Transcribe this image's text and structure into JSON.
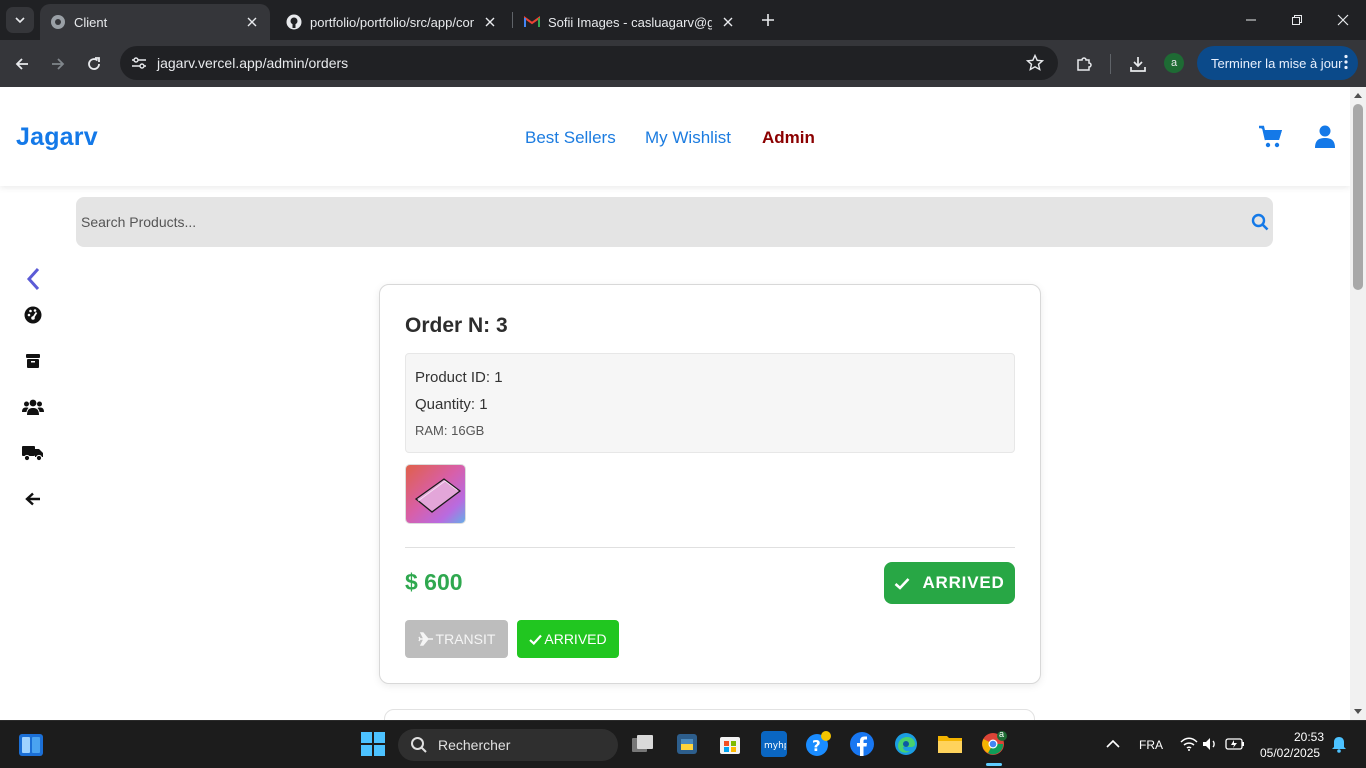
{
  "browser": {
    "tabs": [
      {
        "title": "Client",
        "icon": "globe-icon",
        "active": true
      },
      {
        "title": "portfolio/portfolio/src/app/com",
        "icon": "github-icon",
        "active": false
      },
      {
        "title": "Sofii Images - casluagarv@gma",
        "icon": "gmail-icon",
        "active": false
      }
    ],
    "url": "jagarv.vercel.app/admin/orders",
    "profile_initial": "a",
    "update_button": "Terminer la mise à jour"
  },
  "site": {
    "logo": "Jagarv",
    "nav": [
      "Best Sellers",
      "My Wishlist",
      "Admin"
    ],
    "search_placeholder": "Search Products..."
  },
  "order": {
    "title": "Order N: 3",
    "product_id": "Product ID: 1",
    "quantity": "Quantity: 1",
    "ram": "RAM: 16GB",
    "price": "$ 600",
    "status": "ARRIVED",
    "status_color": "#28a745",
    "transit_label": "TRANSIT",
    "arrived_label": "ARRIVED"
  },
  "taskbar": {
    "search_placeholder": "Rechercher",
    "language": "FRA",
    "time": "20:53",
    "date": "05/02/2025",
    "notification_badge": "a"
  },
  "colors": {
    "brand_blue": "#1479e8",
    "admin_red": "#8b0000",
    "price_green": "#2fa84f",
    "arrived_green": "#21c620"
  }
}
